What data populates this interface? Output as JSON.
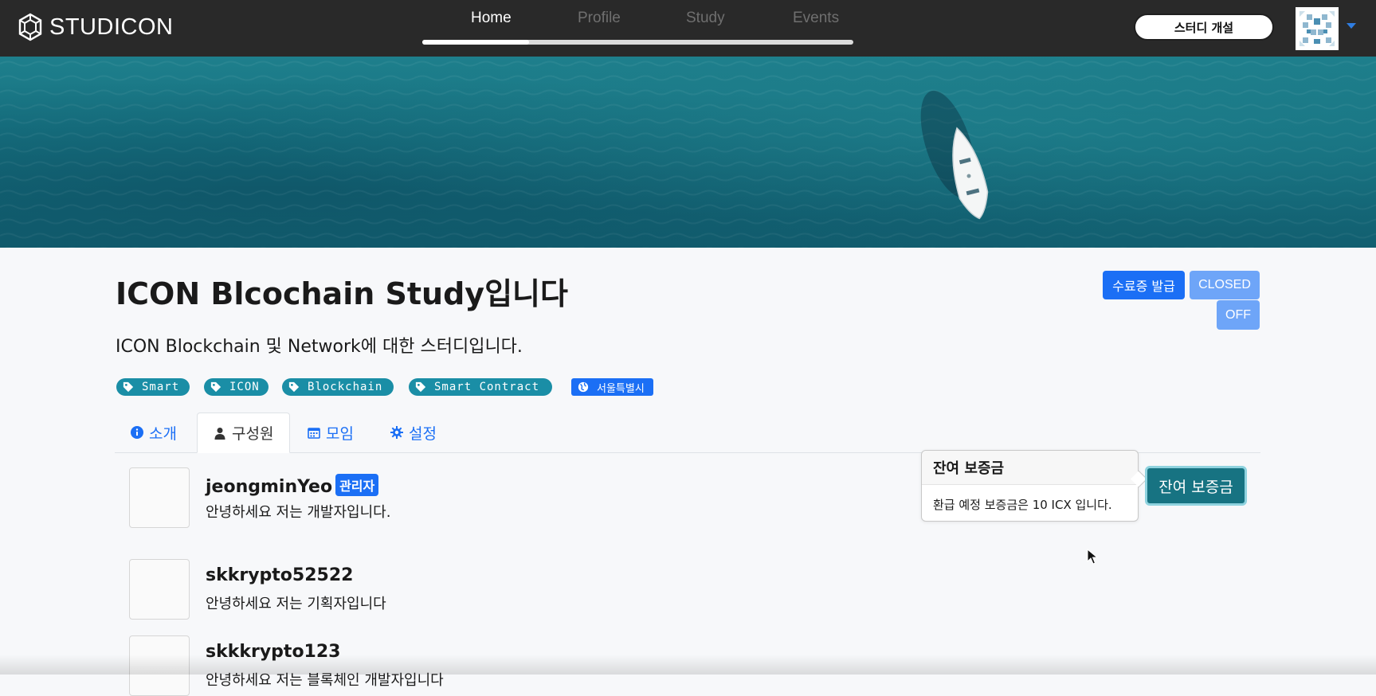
{
  "brand": {
    "name": "STUDICON"
  },
  "nav": {
    "items": [
      {
        "label": "Home",
        "active": true
      },
      {
        "label": "Profile",
        "active": false
      },
      {
        "label": "Study",
        "active": false
      },
      {
        "label": "Events",
        "active": false
      }
    ],
    "progress": 0.25
  },
  "header": {
    "create_study_label": "스터디 개설",
    "avatar_icon": "identicon-avatar",
    "menu_icon": "caret-down-icon"
  },
  "hero": {
    "image": "aerial-ocean-boat"
  },
  "study": {
    "title": "ICON Blcochain Study입니다",
    "description": "ICON Blockchain 및 Network에 대한 스터디입니다.",
    "certificate_button": "수료증 발급",
    "status_badge": "CLOSED",
    "mode_badge": "OFF",
    "tags": [
      "Smart",
      "ICON",
      "Blockchain",
      "Smart Contract"
    ],
    "region": "서울특별시"
  },
  "tabs": [
    {
      "label": "소개",
      "icon": "info-icon"
    },
    {
      "label": "구성원",
      "icon": "user-icon",
      "active": true
    },
    {
      "label": "모임",
      "icon": "calendar-icon"
    },
    {
      "label": "설정",
      "icon": "gear-icon"
    }
  ],
  "members": [
    {
      "name": "jeongminYeo",
      "badge": "관리자",
      "description": "안녕하세요 저는 개발자입니다."
    },
    {
      "name": "skkrypto52522",
      "description": "안녕하세요 저는 기획자입니다"
    },
    {
      "name": "skkkrypto123",
      "description": "안녕하세요 저는 블록체인 개발자입니다"
    }
  ],
  "deposit": {
    "button_label": "잔여 보증금",
    "popover_title": "잔여 보증금",
    "popover_body": "환급 예정 보증금은 10 ICX 입니다."
  },
  "colors": {
    "nav_bg": "#292929",
    "primary": "#1b6ff5",
    "tag": "#1a8ea6",
    "teal": "#177382"
  }
}
